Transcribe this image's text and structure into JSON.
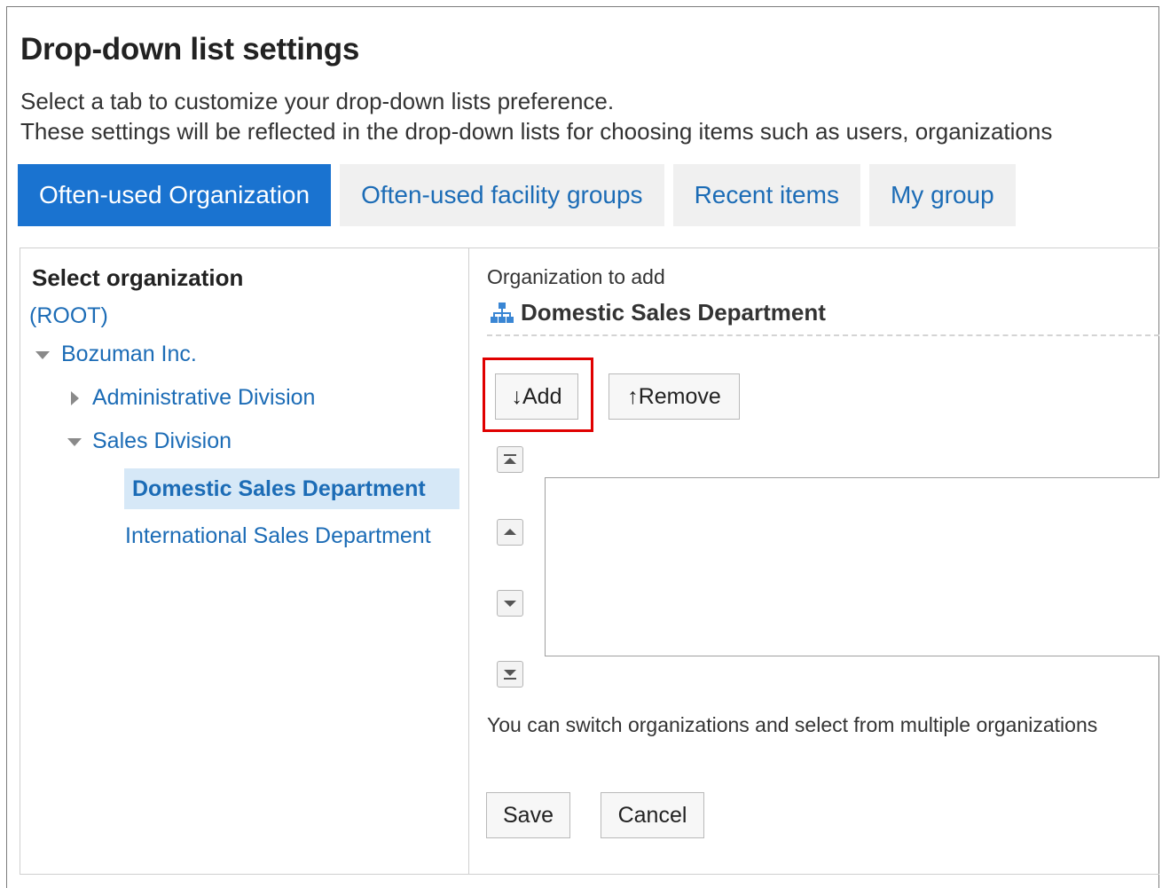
{
  "page": {
    "title": "Drop-down list settings",
    "description_line1": "Select a tab to customize your drop-down lists preference.",
    "description_line2": "These settings will be reflected in the drop-down lists for choosing items such as users, organizations"
  },
  "tabs": [
    {
      "label": "Often-used Organization",
      "active": true
    },
    {
      "label": "Often-used facility groups",
      "active": false
    },
    {
      "label": "Recent items",
      "active": false
    },
    {
      "label": "My group",
      "active": false
    }
  ],
  "tree": {
    "title": "Select organization",
    "root": "(ROOT)",
    "company": "Bozuman Inc.",
    "items": [
      {
        "label": "Administrative Division",
        "expanded": false
      },
      {
        "label": "Sales Division",
        "expanded": true
      }
    ],
    "children": [
      {
        "label": "Domestic Sales Department",
        "selected": true
      },
      {
        "label": "International Sales Department",
        "selected": false
      }
    ]
  },
  "detail": {
    "org_label": "Organization to add",
    "org_name": "Domestic Sales Department",
    "org_icon": "organization-icon",
    "add_button": "↓Add",
    "remove_button": "↑Remove",
    "order_buttons": [
      "move-top-icon",
      "move-up-icon",
      "move-down-icon",
      "move-bottom-icon"
    ],
    "note": "You can switch organizations and select from multiple organizations",
    "save_button": "Save",
    "cancel_button": "Cancel"
  },
  "colors": {
    "accent": "#1a73d0",
    "link": "#1c6cb6",
    "highlight": "#e00000",
    "selected_bg": "#d6e8f7"
  }
}
